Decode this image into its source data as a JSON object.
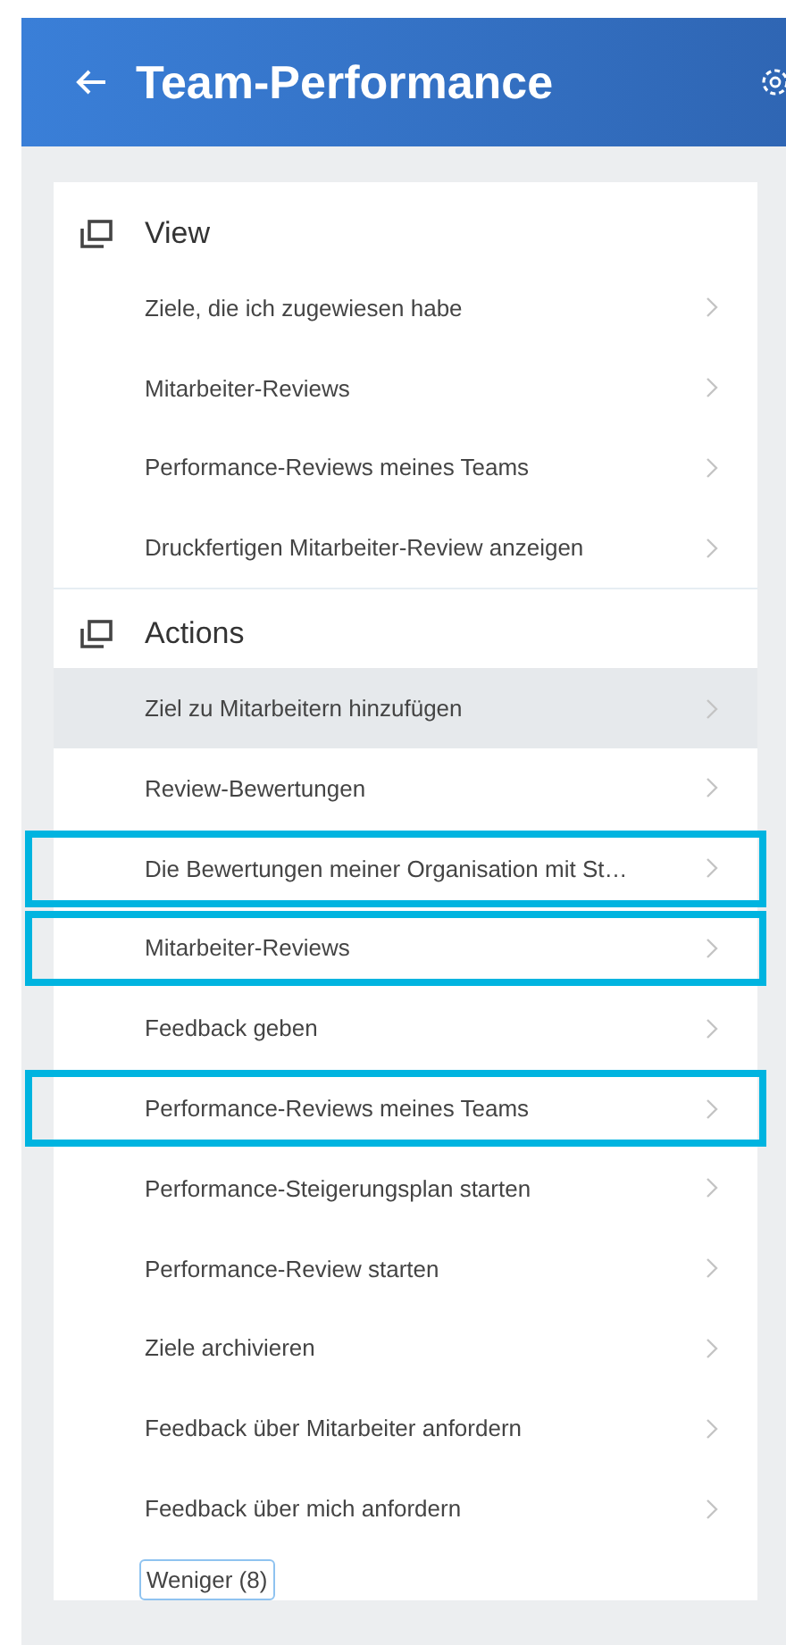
{
  "header": {
    "title": "Team-Performance"
  },
  "sections": [
    {
      "title": "View",
      "items": [
        {
          "label": "Ziele, die ich zugewiesen habe",
          "selected": false,
          "outlined": false
        },
        {
          "label": "Mitarbeiter-Reviews",
          "selected": false,
          "outlined": false
        },
        {
          "label": "Performance-Reviews meines Teams",
          "selected": false,
          "outlined": false
        },
        {
          "label": "Druckfertigen Mitarbeiter-Review anzeigen",
          "selected": false,
          "outlined": false
        }
      ]
    },
    {
      "title": "Actions",
      "items": [
        {
          "label": "Ziel zu Mitarbeitern hinzufügen",
          "selected": true,
          "outlined": false
        },
        {
          "label": "Review-Bewertungen",
          "selected": false,
          "outlined": false
        },
        {
          "label": "Die Bewertungen meiner Organisation mit St…",
          "selected": false,
          "outlined": true
        },
        {
          "label": "Mitarbeiter-Reviews",
          "selected": false,
          "outlined": true
        },
        {
          "label": "Feedback geben",
          "selected": false,
          "outlined": false
        },
        {
          "label": "Performance-Reviews meines Teams",
          "selected": false,
          "outlined": true
        },
        {
          "label": "Performance-Steigerungsplan starten",
          "selected": false,
          "outlined": false
        },
        {
          "label": "Performance-Review starten",
          "selected": false,
          "outlined": false
        },
        {
          "label": "Ziele archivieren",
          "selected": false,
          "outlined": false
        },
        {
          "label": "Feedback über Mitarbeiter anfordern",
          "selected": false,
          "outlined": false
        },
        {
          "label": "Feedback über mich anfordern",
          "selected": false,
          "outlined": false
        }
      ],
      "more_button": "Weniger (8)"
    }
  ]
}
